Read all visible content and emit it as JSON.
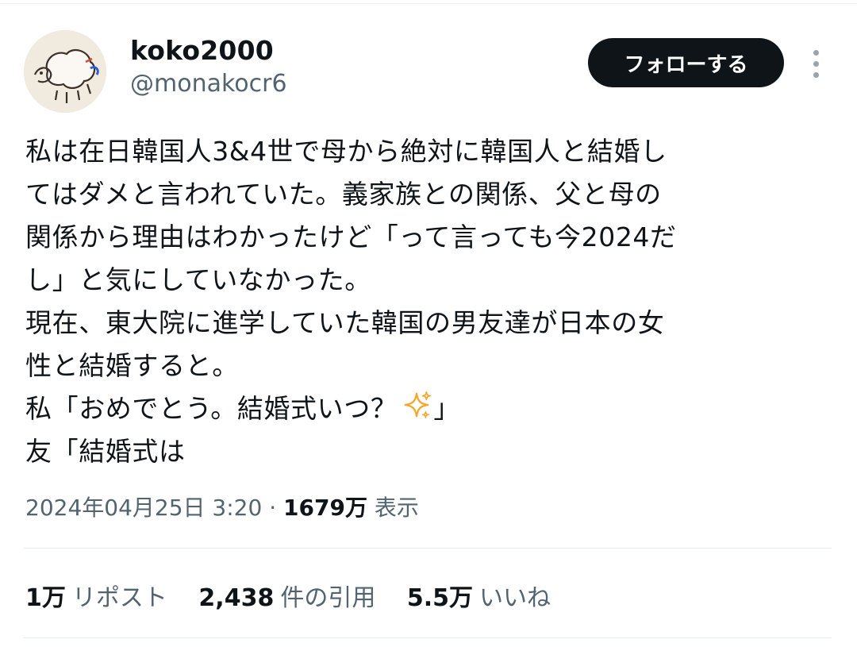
{
  "author": {
    "display_name": "koko2000",
    "handle": "@monakocr6",
    "follow_label": "フォローする"
  },
  "tweet": {
    "lines": [
      "私は在日韓国人3&4世で母から絶対に韓国人と結婚し",
      "てはダメと言われていた。義家族との関係、父と母の",
      "関係から理由はわかったけど「って言っても今2024だ",
      "し」と気にしていなかった。",
      "現在、東大院に進学していた韓国の男友達が日本の女",
      "性と結婚すると。",
      "私「おめでとう。結婚式いつ？",
      "」",
      "友「結婚式は"
    ]
  },
  "meta": {
    "timestamp": "2024年04月25日 3:20",
    "separator": "·",
    "views_count": "1679万",
    "views_label": "表示"
  },
  "stats": {
    "reposts_count": "1万",
    "reposts_label": "リポスト",
    "quotes_count": "2,438",
    "quotes_label": "件の引用",
    "likes_count": "5.5万",
    "likes_label": "いいね"
  },
  "colors": {
    "text": "#0f1419",
    "secondary_text": "#536471",
    "follow_button_bg": "#0f1419",
    "sparkle": "#f4a62a"
  },
  "icons": {
    "more": "more-vertical-icon",
    "sparkles": "sparkles-icon"
  }
}
